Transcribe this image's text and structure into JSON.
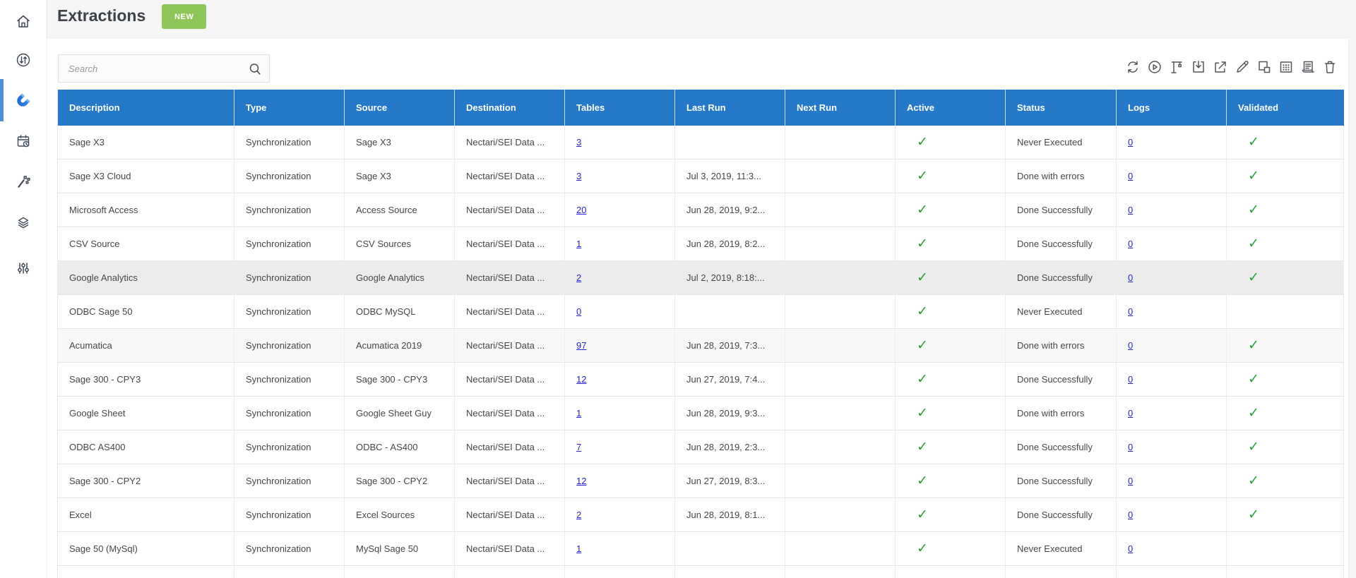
{
  "page": {
    "title": "Extractions",
    "new_button_label": "NEW"
  },
  "search": {
    "placeholder": "Search",
    "value": ""
  },
  "colors": {
    "header_blue": "#2678c9",
    "new_button_green": "#8fc65a",
    "check_green": "#28a22c",
    "link_blue": "#2424d9",
    "active_indicator_blue": "#4d90d8",
    "selected_row_gray": "#ececec"
  },
  "icons": {
    "check": "✓"
  },
  "sidebar": {
    "items": [
      {
        "name": "home"
      },
      {
        "name": "data-transfer"
      },
      {
        "name": "extractions-magnet",
        "active": true
      },
      {
        "name": "scheduler-calendar"
      },
      {
        "name": "processes-wand"
      },
      {
        "name": "layers"
      },
      {
        "name": "settings-sliders"
      }
    ]
  },
  "toolbar": {
    "icons": [
      "refresh",
      "run",
      "build-crane",
      "download",
      "export",
      "edit",
      "copy",
      "table-grid",
      "logs-document",
      "delete"
    ]
  },
  "table": {
    "columns": [
      "Description",
      "Type",
      "Source",
      "Destination",
      "Tables",
      "Last Run",
      "Next Run",
      "Active",
      "Status",
      "Logs",
      "Validated"
    ],
    "rows": [
      {
        "description": "Sage X3",
        "type": "Synchronization",
        "source": "Sage X3",
        "destination": "Nectari/SEI Data ...",
        "tables": "3",
        "last_run": "",
        "next_run": "",
        "active": true,
        "status": "Never Executed",
        "logs": "0",
        "validated": true
      },
      {
        "description": "Sage X3 Cloud",
        "type": "Synchronization",
        "source": "Sage X3",
        "destination": "Nectari/SEI Data ...",
        "tables": "3",
        "last_run": "Jul 3, 2019, 11:3...",
        "next_run": "",
        "active": true,
        "status": "Done with errors",
        "logs": "0",
        "validated": true
      },
      {
        "description": "Microsoft Access",
        "type": "Synchronization",
        "source": "Access Source",
        "destination": "Nectari/SEI Data ...",
        "tables": "20",
        "last_run": "Jun 28, 2019, 9:2...",
        "next_run": "",
        "active": true,
        "status": "Done Successfully",
        "logs": "0",
        "validated": true
      },
      {
        "description": "CSV Source",
        "type": "Synchronization",
        "source": "CSV Sources",
        "destination": "Nectari/SEI Data ...",
        "tables": "1",
        "last_run": "Jun 28, 2019, 8:2...",
        "next_run": "",
        "active": true,
        "status": "Done Successfully",
        "logs": "0",
        "validated": true
      },
      {
        "description": "Google Analytics",
        "type": "Synchronization",
        "source": "Google Analytics",
        "destination": "Nectari/SEI Data ...",
        "tables": "2",
        "last_run": "Jul 2, 2019, 8:18:...",
        "next_run": "",
        "active": true,
        "status": "Done Successfully",
        "logs": "0",
        "validated": true,
        "selected": true
      },
      {
        "description": "ODBC Sage 50",
        "type": "Synchronization",
        "source": "ODBC MySQL",
        "destination": "Nectari/SEI Data ...",
        "tables": "0",
        "last_run": "",
        "next_run": "",
        "active": true,
        "status": "Never Executed",
        "logs": "0",
        "validated": false
      },
      {
        "description": "Acumatica",
        "type": "Synchronization",
        "source": "Acumatica 2019",
        "destination": "Nectari/SEI Data ...",
        "tables": "97",
        "last_run": "Jun 28, 2019, 7:3...",
        "next_run": "",
        "active": true,
        "status": "Done with errors",
        "logs": "0",
        "validated": true,
        "shaded": true
      },
      {
        "description": "Sage 300 - CPY3",
        "type": "Synchronization",
        "source": "Sage 300 - CPY3",
        "destination": "Nectari/SEI Data ...",
        "tables": "12",
        "last_run": "Jun 27, 2019, 7:4...",
        "next_run": "",
        "active": true,
        "status": "Done Successfully",
        "logs": "0",
        "validated": true
      },
      {
        "description": "Google Sheet",
        "type": "Synchronization",
        "source": "Google Sheet Guy",
        "destination": "Nectari/SEI Data ...",
        "tables": "1",
        "last_run": "Jun 28, 2019, 9:3...",
        "next_run": "",
        "active": true,
        "status": "Done with errors",
        "logs": "0",
        "validated": true
      },
      {
        "description": "ODBC AS400",
        "type": "Synchronization",
        "source": "ODBC - AS400",
        "destination": "Nectari/SEI Data ...",
        "tables": "7",
        "last_run": "Jun 28, 2019, 2:3...",
        "next_run": "",
        "active": true,
        "status": "Done Successfully",
        "logs": "0",
        "validated": true
      },
      {
        "description": "Sage 300 - CPY2",
        "type": "Synchronization",
        "source": "Sage 300 - CPY2",
        "destination": "Nectari/SEI Data ...",
        "tables": "12",
        "last_run": "Jun 27, 2019, 8:3...",
        "next_run": "",
        "active": true,
        "status": "Done Successfully",
        "logs": "0",
        "validated": true
      },
      {
        "description": "Excel",
        "type": "Synchronization",
        "source": "Excel Sources",
        "destination": "Nectari/SEI Data ...",
        "tables": "2",
        "last_run": "Jun 28, 2019, 8:1...",
        "next_run": "",
        "active": true,
        "status": "Done Successfully",
        "logs": "0",
        "validated": true
      },
      {
        "description": "Sage 50 (MySql)",
        "type": "Synchronization",
        "source": "MySql Sage 50",
        "destination": "Nectari/SEI Data ...",
        "tables": "1",
        "last_run": "",
        "next_run": "",
        "active": true,
        "status": "Never Executed",
        "logs": "0",
        "validated": false
      }
    ]
  }
}
